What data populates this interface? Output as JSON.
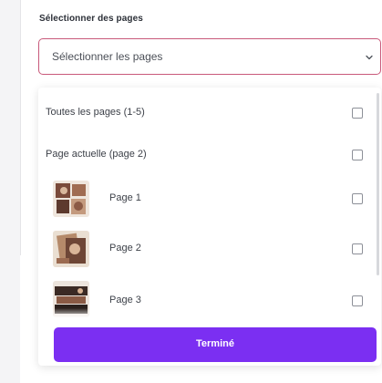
{
  "section_label": "Sélectionner des pages",
  "select": {
    "value": "Sélectionner les pages"
  },
  "options": [
    {
      "label": "Toutes les pages (1-5)",
      "checked": false
    },
    {
      "label": "Page actuelle (page 2)",
      "checked": false
    }
  ],
  "pages": [
    {
      "label": "Page 1",
      "checked": false
    },
    {
      "label": "Page 2",
      "checked": false
    },
    {
      "label": "Page 3",
      "checked": false
    }
  ],
  "done_button": {
    "label": "Terminé"
  },
  "colors": {
    "accent": "#7b2ff2",
    "select_border": "#c8597a"
  }
}
